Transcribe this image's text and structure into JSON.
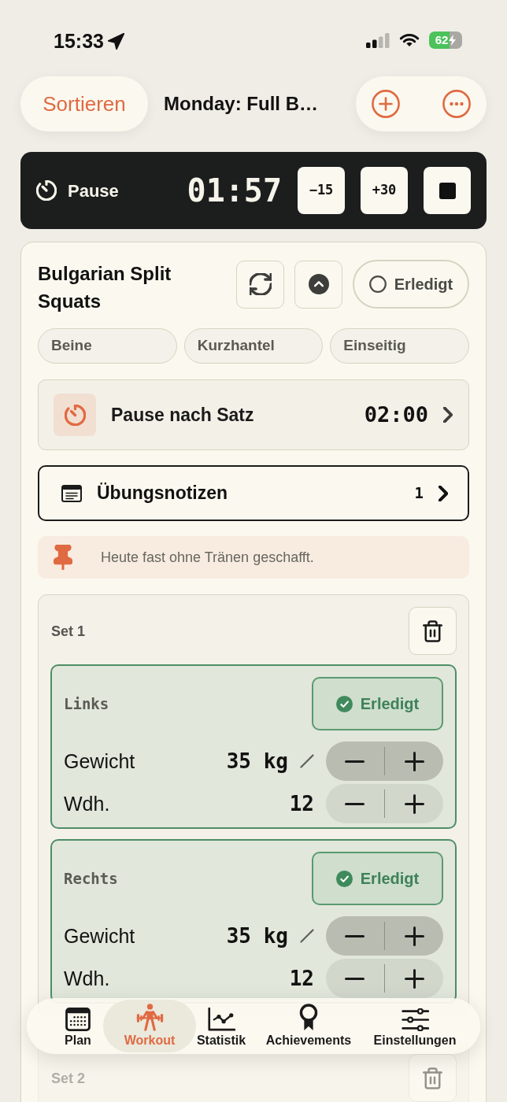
{
  "status_bar": {
    "time": "15:33",
    "battery": "62"
  },
  "header": {
    "sort_button": "Sortieren",
    "title": "Monday: Full B…"
  },
  "rest_timer": {
    "label": "Pause",
    "time": "01:57",
    "adjust_buttons": [
      "−15",
      "+30"
    ]
  },
  "exercise": {
    "name": "Bulgarian Split Squats",
    "done": false,
    "done_label": "Erledigt",
    "tags": [
      "Beine",
      "Kurzhantel",
      "Einseitig"
    ],
    "rest_after_set": {
      "label": "Pause nach Satz",
      "time": "02:00"
    },
    "notes": {
      "label": "Übungsnotizen",
      "count": "1"
    },
    "pinned_note": "Heute fast ohne Tränen geschafft.",
    "sets": [
      {
        "title": "Set 1",
        "sides": [
          {
            "label": "Links",
            "done": true,
            "done_label": "Erledigt",
            "rows": [
              {
                "kind": "weight",
                "label": "Gewicht",
                "value": "35 kg"
              },
              {
                "kind": "reps",
                "label": "Wdh.",
                "value": "12"
              }
            ]
          },
          {
            "label": "Rechts",
            "done": true,
            "done_label": "Erledigt",
            "rows": [
              {
                "kind": "weight",
                "label": "Gewicht",
                "value": "35 kg"
              },
              {
                "kind": "reps",
                "label": "Wdh.",
                "value": "12"
              }
            ]
          }
        ]
      },
      {
        "title": "Set 2"
      }
    ]
  },
  "tab_bar": {
    "items": [
      {
        "label": "Plan",
        "selected": false
      },
      {
        "label": "Workout",
        "selected": true
      },
      {
        "label": "Statistik",
        "selected": false
      },
      {
        "label": "Achievements",
        "selected": false
      },
      {
        "label": "Einstellungen",
        "selected": false
      }
    ]
  }
}
